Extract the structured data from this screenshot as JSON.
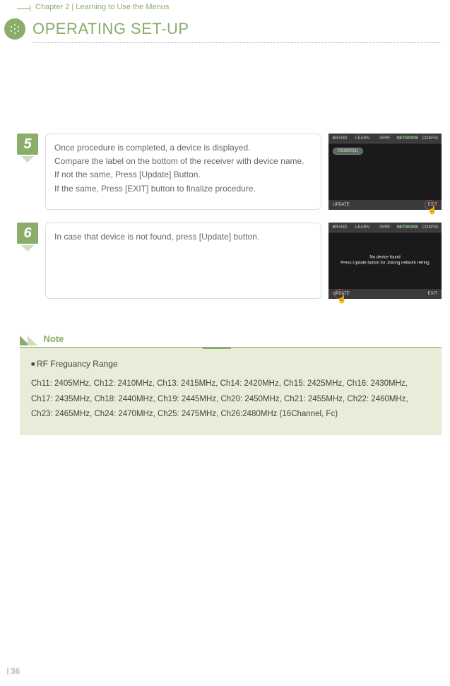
{
  "header": {
    "chapter": "Chapter 2 | Learning to Use the Menus",
    "title": "OPERATING SET-UP"
  },
  "steps": [
    {
      "num": "5",
      "lines": [
        "Once procedure is completed, a device is displayed.",
        "Compare the label on the bottom of the receiver with device name.",
        "If not the same, Press [Update] Button.",
        "If the same, Press [EXIT] button to finalize procedure."
      ],
      "shot": {
        "tabs": [
          "BRAND",
          "LEARN",
          "IR/RF",
          "NETWORK",
          "CONFIG"
        ],
        "active_tab": "NETWORK",
        "device": "RS3000(1)",
        "footer_left": "UPDATE",
        "footer_right": "EXIT",
        "pointer": "right"
      }
    },
    {
      "num": "6",
      "lines": [
        "In case that device is not found, press [Update] button."
      ],
      "shot": {
        "tabs": [
          "BRAND",
          "LEARN",
          "IR/RF",
          "NETWORK",
          "CONFIG"
        ],
        "active_tab": "NETWORK",
        "msg_line1": "No device found",
        "msg_line2": "Press Update button for Joining network retring",
        "footer_left": "UPDATE",
        "footer_right": "EXIT",
        "pointer": "left"
      }
    }
  ],
  "note": {
    "label": "Note",
    "subtitle": "RF Freguancy Range",
    "body": "Ch11: 2405MHz, Ch12: 2410MHz, Ch13: 2415MHz, Ch14: 2420MHz, Ch15: 2425MHz, Ch16: 2430MHz, Ch17: 2435MHz, Ch18: 2440MHz, Ch19: 2445MHz, Ch20: 2450MHz, Ch21: 2455MHz, Ch22: 2460MHz, Ch23: 2465MHz, Ch24: 2470MHz, Ch25: 2475MHz, Ch26:2480MHz (16Channel, Fc)"
  },
  "page_number": "36"
}
